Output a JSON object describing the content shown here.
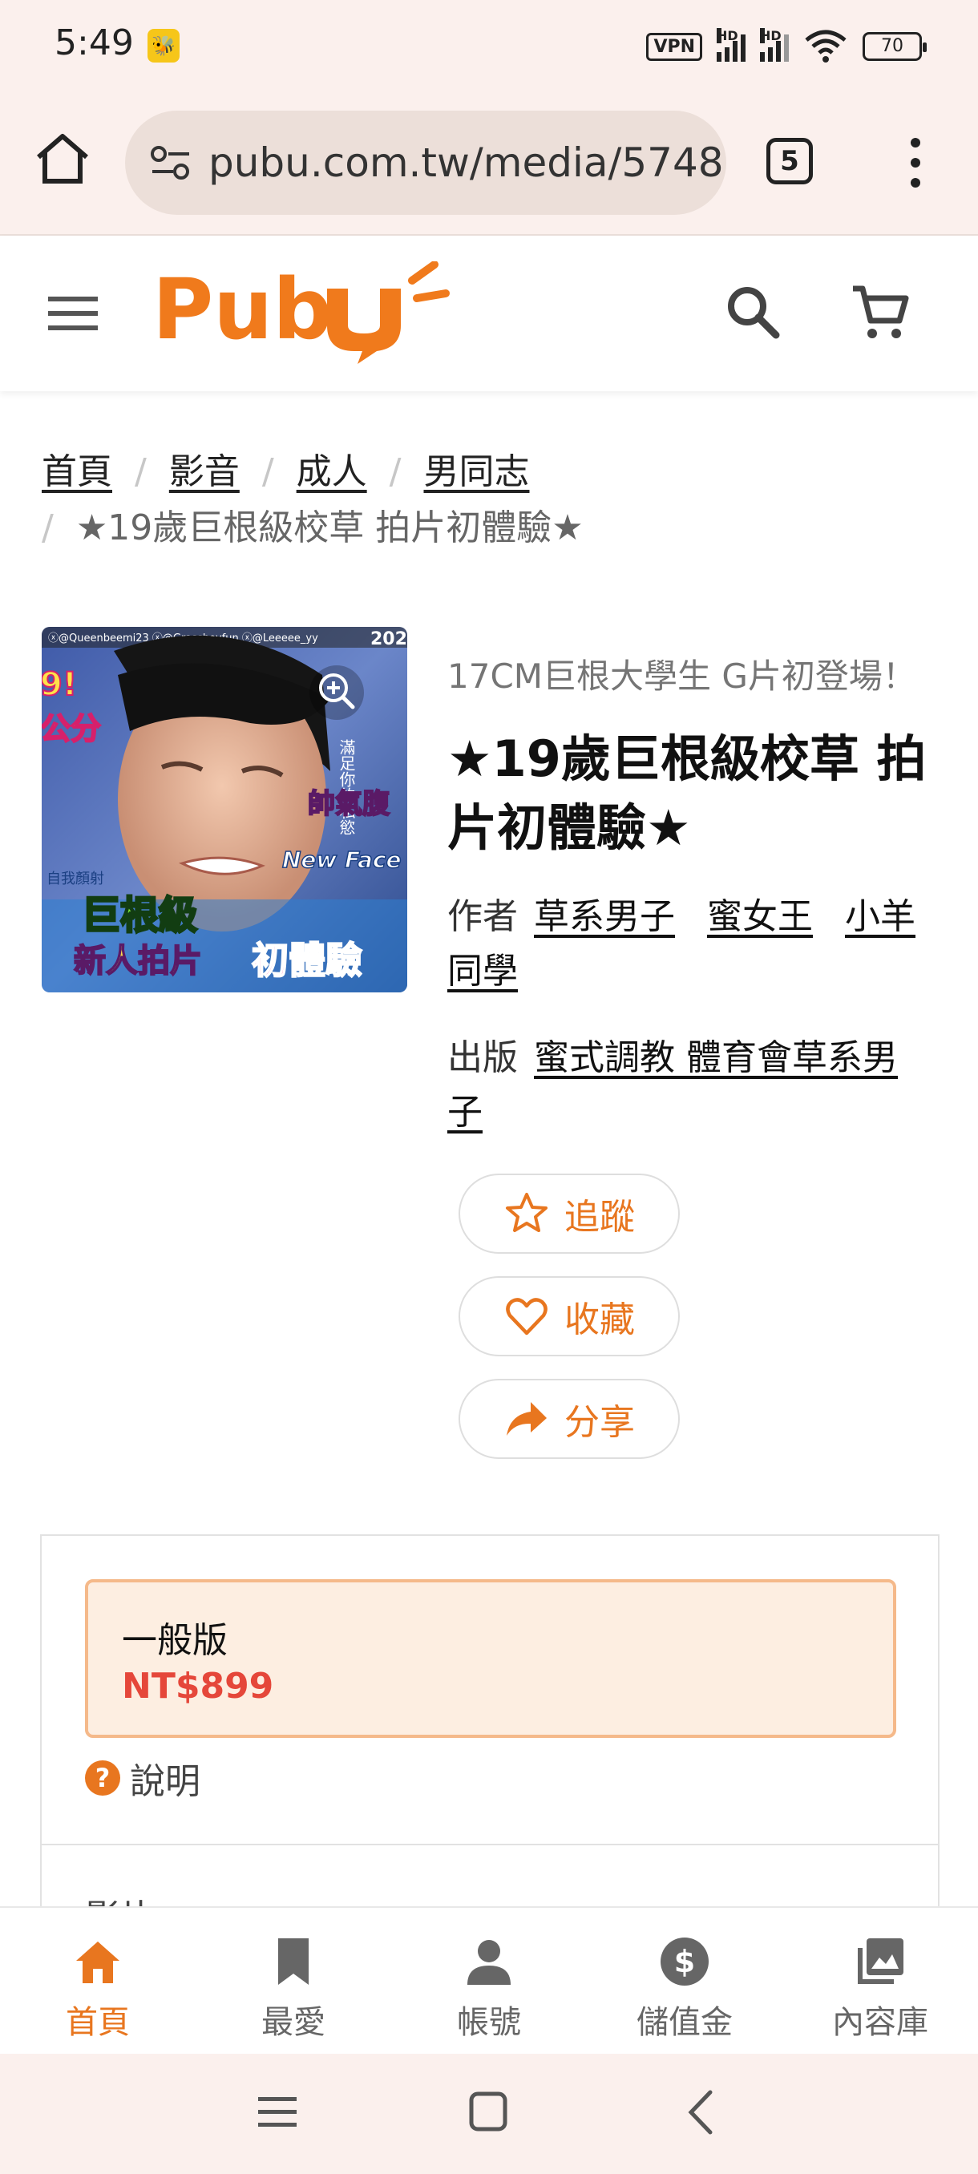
{
  "status_bar": {
    "time": "5:49",
    "app_icon": "bee-app-icon",
    "vpn": "VPN",
    "hd1": "HD",
    "hd2": "HD",
    "battery": "70"
  },
  "browser": {
    "url": "pubu.com.tw/media/5748",
    "tab_count": "5"
  },
  "site": {
    "brand": "PubU",
    "brand_color": "#f07a1c"
  },
  "breadcrumb": {
    "items": [
      "首頁",
      "影音",
      "成人",
      "男同志"
    ],
    "current": "★19歲巨根級校草 拍片初體驗★"
  },
  "product": {
    "subtitle": "17CM巨根大學生 G片初登場！",
    "title": "★19歲巨根級校草 拍片初體驗★",
    "author_label": "作者",
    "authors": [
      "草系男子",
      "蜜女王",
      "小羊同學"
    ],
    "publisher_label": "出版",
    "publisher": "蜜式調教 體育會草系男子",
    "cover_text": {
      "handles": "ⓧ@Queenbeemi23 ⓧ@Grassboyfun ⓧ@Leeeee_yy",
      "year": "202",
      "left1": "9!",
      "left2": "公分",
      "side1": "自我顏射",
      "vertical": "滿足你的私慾",
      "badge": "帥氣腹",
      "newface": "New Face",
      "big1": "巨根級",
      "big2": "新人拍片",
      "big3": "初體驗"
    }
  },
  "actions": {
    "follow": "追蹤",
    "favorite": "收藏",
    "share": "分享"
  },
  "purchase": {
    "edition": "一般版",
    "price": "NT$899",
    "help": "說明",
    "next_section": "影片"
  },
  "bottom_nav": {
    "items": [
      {
        "label": "首頁",
        "icon": "home-icon"
      },
      {
        "label": "最愛",
        "icon": "bookmark-icon"
      },
      {
        "label": "帳號",
        "icon": "person-icon"
      },
      {
        "label": "儲值金",
        "icon": "dollar-icon"
      },
      {
        "label": "內容庫",
        "icon": "library-icon"
      }
    ],
    "active_color": "#e8761f"
  }
}
